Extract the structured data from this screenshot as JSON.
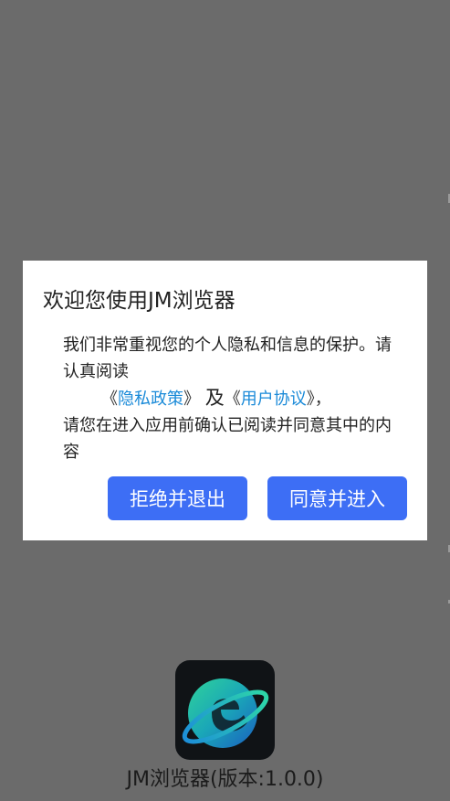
{
  "dialog": {
    "title": "欢迎您使用JM浏览器",
    "body_line1": "我们非常重视您的个人隐私和信息的保护。请认真阅读",
    "bracket_open_1": "《",
    "privacy_link": "隐私政策",
    "bracket_close_1": "》",
    "and_text": "及",
    "bracket_open_2": "《",
    "agreement_link": "用户协议",
    "bracket_close_2": "》，",
    "body_line3": "请您在进入应用前确认已阅读并同意其中的内容",
    "reject_label": "拒绝并退出",
    "agree_label": "同意并进入"
  },
  "splash": {
    "app_name": "JM浏览器(版本:1.0.0)",
    "icon_name": "jm-browser-logo-icon"
  },
  "colors": {
    "overlay": "#6b6b6b",
    "button": "#3d6ef5",
    "link": "#1a8ad8"
  }
}
